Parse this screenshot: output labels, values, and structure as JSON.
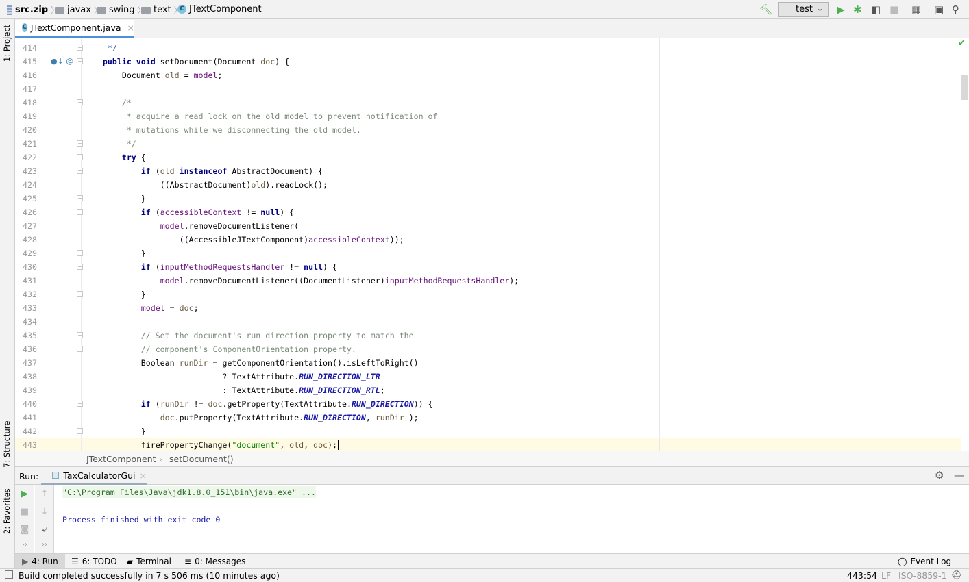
{
  "navbar": {
    "crumbs": [
      "src.zip",
      "javax",
      "swing",
      "text",
      "JTextComponent"
    ],
    "run_config": "test"
  },
  "left_strip": {
    "project": "1: Project",
    "structure": "7: Structure",
    "favorites": "2: Favorites"
  },
  "editor": {
    "tab": "JTextComponent.java",
    "lines": [
      {
        "n": "414",
        "t": [
          [
            "dc",
            "     */"
          ]
        ]
      },
      {
        "n": "415",
        "t": [
          [
            "",
            "    "
          ],
          [
            "k",
            "public void"
          ],
          [
            "",
            " setDocument(Document "
          ],
          [
            "p",
            "doc"
          ],
          [
            "",
            ") {"
          ]
        ]
      },
      {
        "n": "416",
        "t": [
          [
            "",
            "        Document "
          ],
          [
            "p",
            "old"
          ],
          [
            "",
            " = "
          ],
          [
            "f",
            "model"
          ],
          [
            "",
            ";"
          ]
        ]
      },
      {
        "n": "417",
        "t": []
      },
      {
        "n": "418",
        "t": [
          [
            "c",
            "        /*"
          ]
        ]
      },
      {
        "n": "419",
        "t": [
          [
            "c",
            "         * acquire a read lock on the old model to prevent notification of"
          ]
        ]
      },
      {
        "n": "420",
        "t": [
          [
            "c",
            "         * mutations while we disconnecting the old model."
          ]
        ]
      },
      {
        "n": "421",
        "t": [
          [
            "c",
            "         */"
          ]
        ]
      },
      {
        "n": "422",
        "t": [
          [
            "",
            "        "
          ],
          [
            "k",
            "try"
          ],
          [
            "",
            " {"
          ]
        ]
      },
      {
        "n": "423",
        "t": [
          [
            "",
            "            "
          ],
          [
            "k",
            "if"
          ],
          [
            "",
            " ("
          ],
          [
            "p",
            "old"
          ],
          [
            "",
            " "
          ],
          [
            "k",
            "instanceof"
          ],
          [
            "",
            " AbstractDocument) {"
          ]
        ]
      },
      {
        "n": "424",
        "t": [
          [
            "",
            "                ((AbstractDocument)"
          ],
          [
            "p",
            "old"
          ],
          [
            "",
            ").readLock();"
          ]
        ]
      },
      {
        "n": "425",
        "t": [
          [
            "",
            "            }"
          ]
        ]
      },
      {
        "n": "426",
        "t": [
          [
            "",
            "            "
          ],
          [
            "k",
            "if"
          ],
          [
            "",
            " ("
          ],
          [
            "f",
            "accessibleContext"
          ],
          [
            "",
            " != "
          ],
          [
            "k",
            "null"
          ],
          [
            "",
            ") {"
          ]
        ]
      },
      {
        "n": "427",
        "t": [
          [
            "",
            "                "
          ],
          [
            "f",
            "model"
          ],
          [
            "",
            ".removeDocumentListener("
          ]
        ]
      },
      {
        "n": "428",
        "t": [
          [
            "",
            "                    ((AccessibleJTextComponent)"
          ],
          [
            "f",
            "accessibleContext"
          ],
          [
            "",
            "));"
          ]
        ]
      },
      {
        "n": "429",
        "t": [
          [
            "",
            "            }"
          ]
        ]
      },
      {
        "n": "430",
        "t": [
          [
            "",
            "            "
          ],
          [
            "k",
            "if"
          ],
          [
            "",
            " ("
          ],
          [
            "f",
            "inputMethodRequestsHandler"
          ],
          [
            "",
            " != "
          ],
          [
            "k",
            "null"
          ],
          [
            "",
            ") {"
          ]
        ]
      },
      {
        "n": "431",
        "t": [
          [
            "",
            "                "
          ],
          [
            "f",
            "model"
          ],
          [
            "",
            ".removeDocumentListener((DocumentListener)"
          ],
          [
            "f",
            "inputMethodRequestsHandler"
          ],
          [
            "",
            ");"
          ]
        ]
      },
      {
        "n": "432",
        "t": [
          [
            "",
            "            }"
          ]
        ]
      },
      {
        "n": "433",
        "t": [
          [
            "",
            "            "
          ],
          [
            "f",
            "model"
          ],
          [
            "",
            " = "
          ],
          [
            "p",
            "doc"
          ],
          [
            "",
            ";"
          ]
        ]
      },
      {
        "n": "434",
        "t": []
      },
      {
        "n": "435",
        "t": [
          [
            "c",
            "            // Set the document's run direction property to match the"
          ]
        ]
      },
      {
        "n": "436",
        "t": [
          [
            "c",
            "            // component's ComponentOrientation property."
          ]
        ]
      },
      {
        "n": "437",
        "t": [
          [
            "",
            "            Boolean "
          ],
          [
            "p",
            "runDir"
          ],
          [
            "",
            " = getComponentOrientation().isLeftToRight()"
          ]
        ]
      },
      {
        "n": "438",
        "t": [
          [
            "",
            "                             ? TextAttribute."
          ],
          [
            "st",
            "RUN_DIRECTION_LTR"
          ]
        ]
      },
      {
        "n": "439",
        "t": [
          [
            "",
            "                             : TextAttribute."
          ],
          [
            "st",
            "RUN_DIRECTION_RTL"
          ],
          [
            "",
            ";"
          ]
        ]
      },
      {
        "n": "440",
        "t": [
          [
            "",
            "            "
          ],
          [
            "k",
            "if"
          ],
          [
            "",
            " ("
          ],
          [
            "p",
            "runDir"
          ],
          [
            "",
            " != "
          ],
          [
            "p",
            "doc"
          ],
          [
            "",
            ".getProperty(TextAttribute."
          ],
          [
            "st",
            "RUN_DIRECTION"
          ],
          [
            "",
            ")) {"
          ]
        ]
      },
      {
        "n": "441",
        "t": [
          [
            "",
            "                "
          ],
          [
            "p",
            "doc"
          ],
          [
            "",
            ".putProperty(TextAttribute."
          ],
          [
            "st",
            "RUN_DIRECTION"
          ],
          [
            "",
            ", "
          ],
          [
            "p",
            "runDir"
          ],
          [
            "",
            " );"
          ]
        ]
      },
      {
        "n": "442",
        "t": [
          [
            "",
            "            }"
          ]
        ]
      },
      {
        "n": "443",
        "t": [
          [
            "",
            "            firePropertyChange("
          ],
          [
            "s",
            "\"document\""
          ],
          [
            "",
            ", "
          ],
          [
            "p",
            "old"
          ],
          [
            "",
            ", "
          ],
          [
            "p",
            "doc"
          ],
          [
            "",
            ");"
          ]
        ]
      }
    ],
    "breadcrumb": [
      "JTextComponent",
      "setDocument()"
    ]
  },
  "run": {
    "label": "Run:",
    "tab": "TaxCalculatorGui",
    "console": [
      "\"C:\\Program Files\\Java\\jdk1.8.0_151\\bin\\java.exe\" ...",
      "",
      "Process finished with exit code 0"
    ]
  },
  "bottom_tabs": [
    "4: Run",
    "6: TODO",
    "Terminal",
    "0: Messages"
  ],
  "event_log": "Event Log",
  "status": {
    "message": "Build completed successfully in 7 s 506 ms (10 minutes ago)",
    "position": "443:54",
    "line_sep": "LF",
    "encoding": "ISO-8859-1"
  },
  "colors": {
    "run_green": "#4caf50",
    "accent": "#4d90d9",
    "current_line": "#fffae3"
  }
}
